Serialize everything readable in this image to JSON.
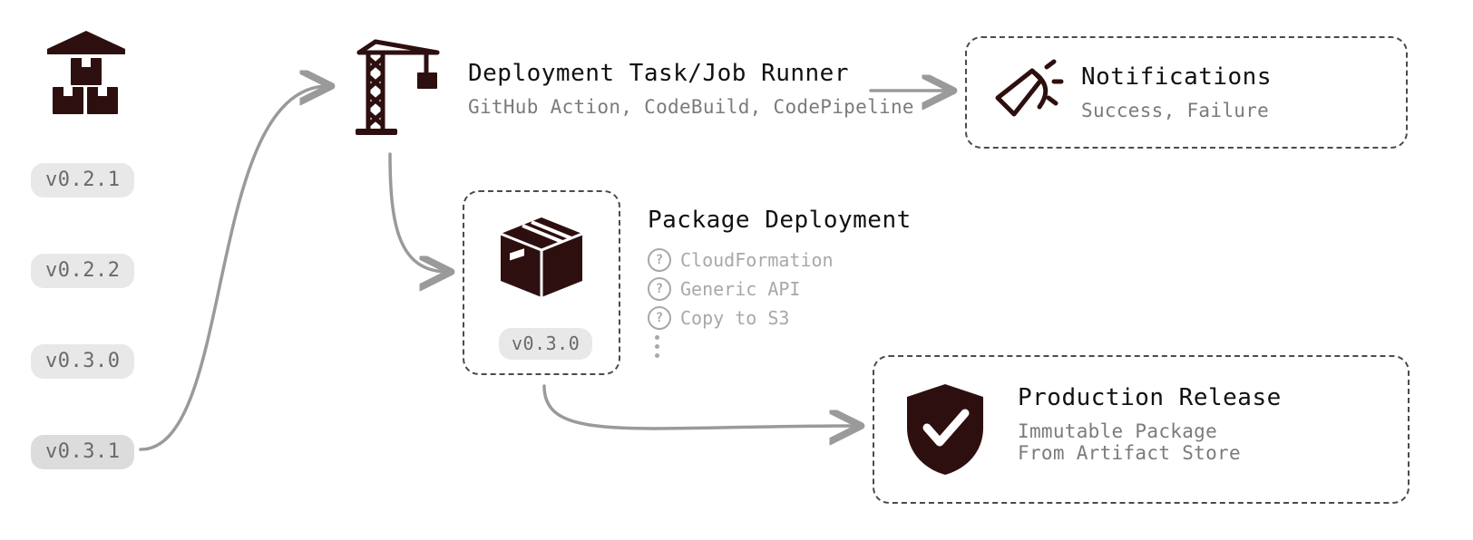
{
  "artifacts": {
    "versions": [
      "v0.2.1",
      "v0.2.2",
      "v0.3.0",
      "v0.3.1"
    ]
  },
  "runner": {
    "title": "Deployment Task/Job Runner",
    "sub": "GitHub Action, CodeBuild, CodePipeline"
  },
  "notifications": {
    "title": "Notifications",
    "sub": "Success, Failure"
  },
  "package_deployment": {
    "title": "Package Deployment",
    "options": [
      "CloudFormation",
      "Generic API",
      "Copy to S3"
    ],
    "selected_version": "v0.3.0"
  },
  "production_release": {
    "title": "Production Release",
    "line1": "Immutable Package",
    "line2": "From Artifact Store"
  }
}
